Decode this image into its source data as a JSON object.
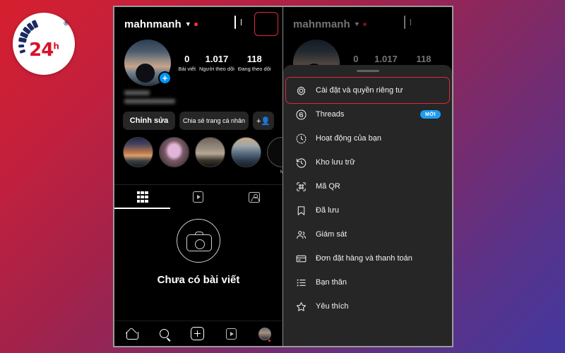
{
  "brand": {
    "name": "24",
    "superscript": "h",
    "registered": "®"
  },
  "profile": {
    "username": "mahnmanh",
    "caret_icon": "chevron-down-icon",
    "unread_dot": true,
    "stats": [
      {
        "value": "0",
        "label": "Bài viết"
      },
      {
        "value": "1.017",
        "label": "Người theo dõi"
      },
      {
        "value": "118",
        "label": "Đang theo dõi"
      }
    ],
    "actions": [
      {
        "label": "Chỉnh sửa",
        "name": "edit-profile-button"
      },
      {
        "label": "Chia sẻ trang cá nhân",
        "name": "share-profile-button"
      },
      {
        "label": "",
        "name": "add-people-button",
        "icon": "person-add-icon"
      }
    ],
    "highlights": [
      {
        "label": ""
      },
      {
        "label": ""
      },
      {
        "label": ""
      },
      {
        "label": ""
      },
      {
        "label": "M"
      }
    ],
    "tabs": [
      {
        "name": "tab-grid",
        "icon": "grid-icon",
        "active": true
      },
      {
        "name": "tab-reels",
        "icon": "reels-icon",
        "active": false
      },
      {
        "name": "tab-tagged",
        "icon": "tagged-icon",
        "active": false
      }
    ],
    "empty_state": {
      "icon": "camera-icon",
      "text": "Chưa có bài viết"
    },
    "header_icons": [
      {
        "name": "add-post-button",
        "icon": "plus-box-icon"
      },
      {
        "name": "menu-button",
        "icon": "hamburger-icon",
        "highlighted": true
      }
    ],
    "bottom_nav": [
      {
        "name": "nav-home",
        "icon": "home-icon"
      },
      {
        "name": "nav-search",
        "icon": "search-icon"
      },
      {
        "name": "nav-create",
        "icon": "plus-box-icon"
      },
      {
        "name": "nav-reels",
        "icon": "reels-icon"
      },
      {
        "name": "nav-profile",
        "icon": "avatar-icon"
      }
    ]
  },
  "menu_sheet": {
    "handle": true,
    "items": [
      {
        "label": "Cài đặt và quyền riêng tư",
        "icon": "gear-icon",
        "name": "menu-item-settings",
        "highlighted": true,
        "badge": ""
      },
      {
        "label": "Threads",
        "icon": "threads-icon",
        "name": "menu-item-threads",
        "highlighted": false,
        "badge": "MỚI"
      },
      {
        "label": "Hoạt động của bạn",
        "icon": "activity-clock-icon",
        "name": "menu-item-your-activity",
        "highlighted": false,
        "badge": ""
      },
      {
        "label": "Kho lưu trữ",
        "icon": "archive-clock-icon",
        "name": "menu-item-archive",
        "highlighted": false,
        "badge": ""
      },
      {
        "label": "Mã QR",
        "icon": "qr-code-icon",
        "name": "menu-item-qr-code",
        "highlighted": false,
        "badge": ""
      },
      {
        "label": "Đã lưu",
        "icon": "bookmark-icon",
        "name": "menu-item-saved",
        "highlighted": false,
        "badge": ""
      },
      {
        "label": "Giám sát",
        "icon": "supervision-people-icon",
        "name": "menu-item-supervision",
        "highlighted": false,
        "badge": ""
      },
      {
        "label": "Đơn đặt hàng và thanh toán",
        "icon": "credit-card-icon",
        "name": "menu-item-orders-payments",
        "highlighted": false,
        "badge": ""
      },
      {
        "label": "Bạn thân",
        "icon": "close-friends-list-icon",
        "name": "menu-item-close-friends",
        "highlighted": false,
        "badge": ""
      },
      {
        "label": "Yêu thích",
        "icon": "star-icon",
        "name": "menu-item-favorites",
        "highlighted": false,
        "badge": ""
      }
    ]
  },
  "colors": {
    "accent_highlight": "#e0293c",
    "badge_blue": "#1f9cf0",
    "ig_blue": "#0095f6",
    "sheet_bg": "#262626"
  }
}
